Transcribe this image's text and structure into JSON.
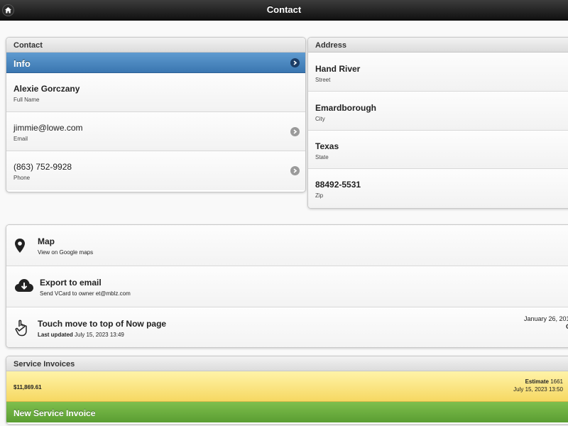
{
  "header": {
    "title": "Contact",
    "home_icon": "home-icon"
  },
  "contact": {
    "heading": "Contact",
    "info_label": "Info",
    "full_name": "Alexie Gorczany",
    "full_name_label": "Full Name",
    "email": "jimmie@lowe.com",
    "email_label": "Email",
    "phone": "(863) 752-9928",
    "phone_label": "Phone"
  },
  "address": {
    "heading": "Address",
    "street": "Hand River",
    "street_label": "Street",
    "city": "Emardborough",
    "city_label": "City",
    "state": "Texas",
    "state_label": "State",
    "zip": "88492-5531",
    "zip_label": "Zip"
  },
  "actions": {
    "map_title": "Map",
    "map_sub": "View on Google maps",
    "export_title": "Export to email",
    "export_sub": "Send VCard to owner et@mblz.com",
    "touch_title": "Touch move to top of Now page",
    "touch_sub_bold": "Last updated",
    "touch_sub_date": "July 15, 2023 13:49",
    "touch_right_date": "January 26, 201",
    "touch_right_extra": "C"
  },
  "invoices": {
    "heading": "Service Invoices",
    "amount": "$11,869.61",
    "estimate_label": "Estimate",
    "estimate_number": "1661",
    "date": "July 15, 2023 13:50",
    "new_label": "New Service Invoice"
  },
  "colors": {
    "header_bg": "#1c1c1c",
    "info_bg": "#4a86c0",
    "invoice_bg": "#fbe47e",
    "new_invoice_bg": "#6aae3e"
  }
}
